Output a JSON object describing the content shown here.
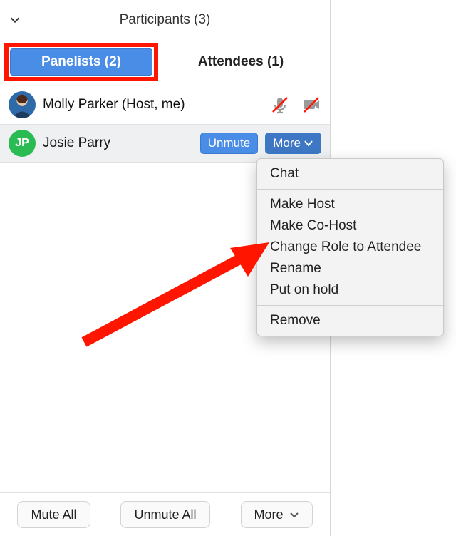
{
  "header": {
    "title": "Participants (3)"
  },
  "tabs": {
    "panelists": "Panelists (2)",
    "attendees": "Attendees (1)"
  },
  "participants": {
    "row0": {
      "name": "Molly Parker (Host, me)"
    },
    "row1": {
      "initials": "JP",
      "name": "Josie Parry",
      "unmute_label": "Unmute",
      "more_label": "More"
    }
  },
  "dropdown": {
    "chat": "Chat",
    "make_host": "Make Host",
    "make_cohost": "Make Co-Host",
    "change_role": "Change Role to Attendee",
    "rename": "Rename",
    "put_on_hold": "Put on hold",
    "remove": "Remove"
  },
  "footer": {
    "mute_all": "Mute All",
    "unmute_all": "Unmute All",
    "more": "More"
  }
}
